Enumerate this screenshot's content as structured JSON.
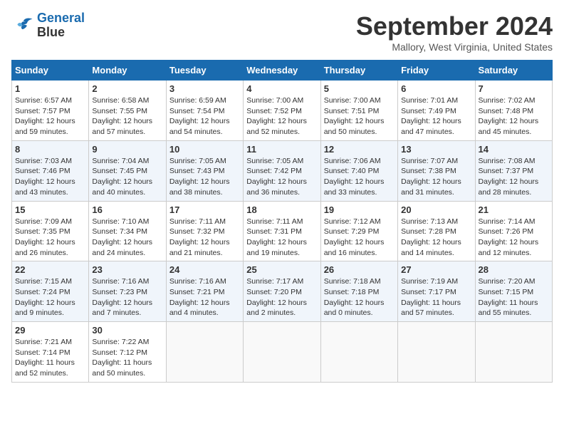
{
  "header": {
    "logo_line1": "General",
    "logo_line2": "Blue",
    "month": "September 2024",
    "location": "Mallory, West Virginia, United States"
  },
  "weekdays": [
    "Sunday",
    "Monday",
    "Tuesday",
    "Wednesday",
    "Thursday",
    "Friday",
    "Saturday"
  ],
  "weeks": [
    [
      {
        "day": "1",
        "sunrise": "6:57 AM",
        "sunset": "7:57 PM",
        "daylight": "12 hours and 59 minutes."
      },
      {
        "day": "2",
        "sunrise": "6:58 AM",
        "sunset": "7:55 PM",
        "daylight": "12 hours and 57 minutes."
      },
      {
        "day": "3",
        "sunrise": "6:59 AM",
        "sunset": "7:54 PM",
        "daylight": "12 hours and 54 minutes."
      },
      {
        "day": "4",
        "sunrise": "7:00 AM",
        "sunset": "7:52 PM",
        "daylight": "12 hours and 52 minutes."
      },
      {
        "day": "5",
        "sunrise": "7:00 AM",
        "sunset": "7:51 PM",
        "daylight": "12 hours and 50 minutes."
      },
      {
        "day": "6",
        "sunrise": "7:01 AM",
        "sunset": "7:49 PM",
        "daylight": "12 hours and 47 minutes."
      },
      {
        "day": "7",
        "sunrise": "7:02 AM",
        "sunset": "7:48 PM",
        "daylight": "12 hours and 45 minutes."
      }
    ],
    [
      {
        "day": "8",
        "sunrise": "7:03 AM",
        "sunset": "7:46 PM",
        "daylight": "12 hours and 43 minutes."
      },
      {
        "day": "9",
        "sunrise": "7:04 AM",
        "sunset": "7:45 PM",
        "daylight": "12 hours and 40 minutes."
      },
      {
        "day": "10",
        "sunrise": "7:05 AM",
        "sunset": "7:43 PM",
        "daylight": "12 hours and 38 minutes."
      },
      {
        "day": "11",
        "sunrise": "7:05 AM",
        "sunset": "7:42 PM",
        "daylight": "12 hours and 36 minutes."
      },
      {
        "day": "12",
        "sunrise": "7:06 AM",
        "sunset": "7:40 PM",
        "daylight": "12 hours and 33 minutes."
      },
      {
        "day": "13",
        "sunrise": "7:07 AM",
        "sunset": "7:38 PM",
        "daylight": "12 hours and 31 minutes."
      },
      {
        "day": "14",
        "sunrise": "7:08 AM",
        "sunset": "7:37 PM",
        "daylight": "12 hours and 28 minutes."
      }
    ],
    [
      {
        "day": "15",
        "sunrise": "7:09 AM",
        "sunset": "7:35 PM",
        "daylight": "12 hours and 26 minutes."
      },
      {
        "day": "16",
        "sunrise": "7:10 AM",
        "sunset": "7:34 PM",
        "daylight": "12 hours and 24 minutes."
      },
      {
        "day": "17",
        "sunrise": "7:11 AM",
        "sunset": "7:32 PM",
        "daylight": "12 hours and 21 minutes."
      },
      {
        "day": "18",
        "sunrise": "7:11 AM",
        "sunset": "7:31 PM",
        "daylight": "12 hours and 19 minutes."
      },
      {
        "day": "19",
        "sunrise": "7:12 AM",
        "sunset": "7:29 PM",
        "daylight": "12 hours and 16 minutes."
      },
      {
        "day": "20",
        "sunrise": "7:13 AM",
        "sunset": "7:28 PM",
        "daylight": "12 hours and 14 minutes."
      },
      {
        "day": "21",
        "sunrise": "7:14 AM",
        "sunset": "7:26 PM",
        "daylight": "12 hours and 12 minutes."
      }
    ],
    [
      {
        "day": "22",
        "sunrise": "7:15 AM",
        "sunset": "7:24 PM",
        "daylight": "12 hours and 9 minutes."
      },
      {
        "day": "23",
        "sunrise": "7:16 AM",
        "sunset": "7:23 PM",
        "daylight": "12 hours and 7 minutes."
      },
      {
        "day": "24",
        "sunrise": "7:16 AM",
        "sunset": "7:21 PM",
        "daylight": "12 hours and 4 minutes."
      },
      {
        "day": "25",
        "sunrise": "7:17 AM",
        "sunset": "7:20 PM",
        "daylight": "12 hours and 2 minutes."
      },
      {
        "day": "26",
        "sunrise": "7:18 AM",
        "sunset": "7:18 PM",
        "daylight": "12 hours and 0 minutes."
      },
      {
        "day": "27",
        "sunrise": "7:19 AM",
        "sunset": "7:17 PM",
        "daylight": "11 hours and 57 minutes."
      },
      {
        "day": "28",
        "sunrise": "7:20 AM",
        "sunset": "7:15 PM",
        "daylight": "11 hours and 55 minutes."
      }
    ],
    [
      {
        "day": "29",
        "sunrise": "7:21 AM",
        "sunset": "7:14 PM",
        "daylight": "11 hours and 52 minutes."
      },
      {
        "day": "30",
        "sunrise": "7:22 AM",
        "sunset": "7:12 PM",
        "daylight": "11 hours and 50 minutes."
      },
      null,
      null,
      null,
      null,
      null
    ]
  ]
}
